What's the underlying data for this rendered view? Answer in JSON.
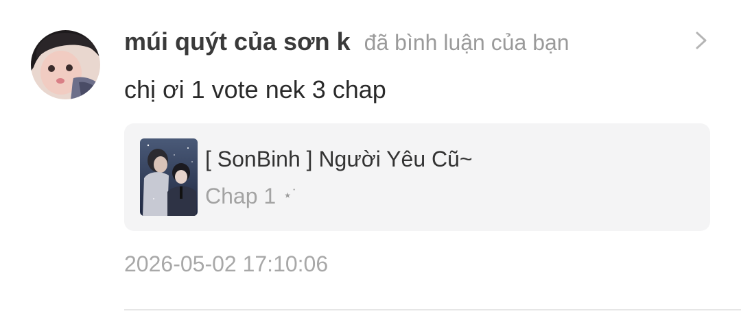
{
  "notification": {
    "username": "múi quýt của sơn k",
    "action": "đã bình luận của bạn",
    "comment": "chị ơi 1 vote nek 3 chap",
    "timestamp": "2026-05-02 17:10:06"
  },
  "story": {
    "title": "[ SonBinh ] Người Yêu Cũ~",
    "chapter": "Chap 1",
    "chapter_suffix": "⋆˙"
  },
  "icons": {
    "chevron": "chevron-right-icon",
    "avatar": "user-avatar-image",
    "cover": "story-cover-image"
  },
  "colors": {
    "username": "#3a3a3a",
    "secondary_text": "#9a9a9a",
    "card_background": "#f4f4f5"
  }
}
